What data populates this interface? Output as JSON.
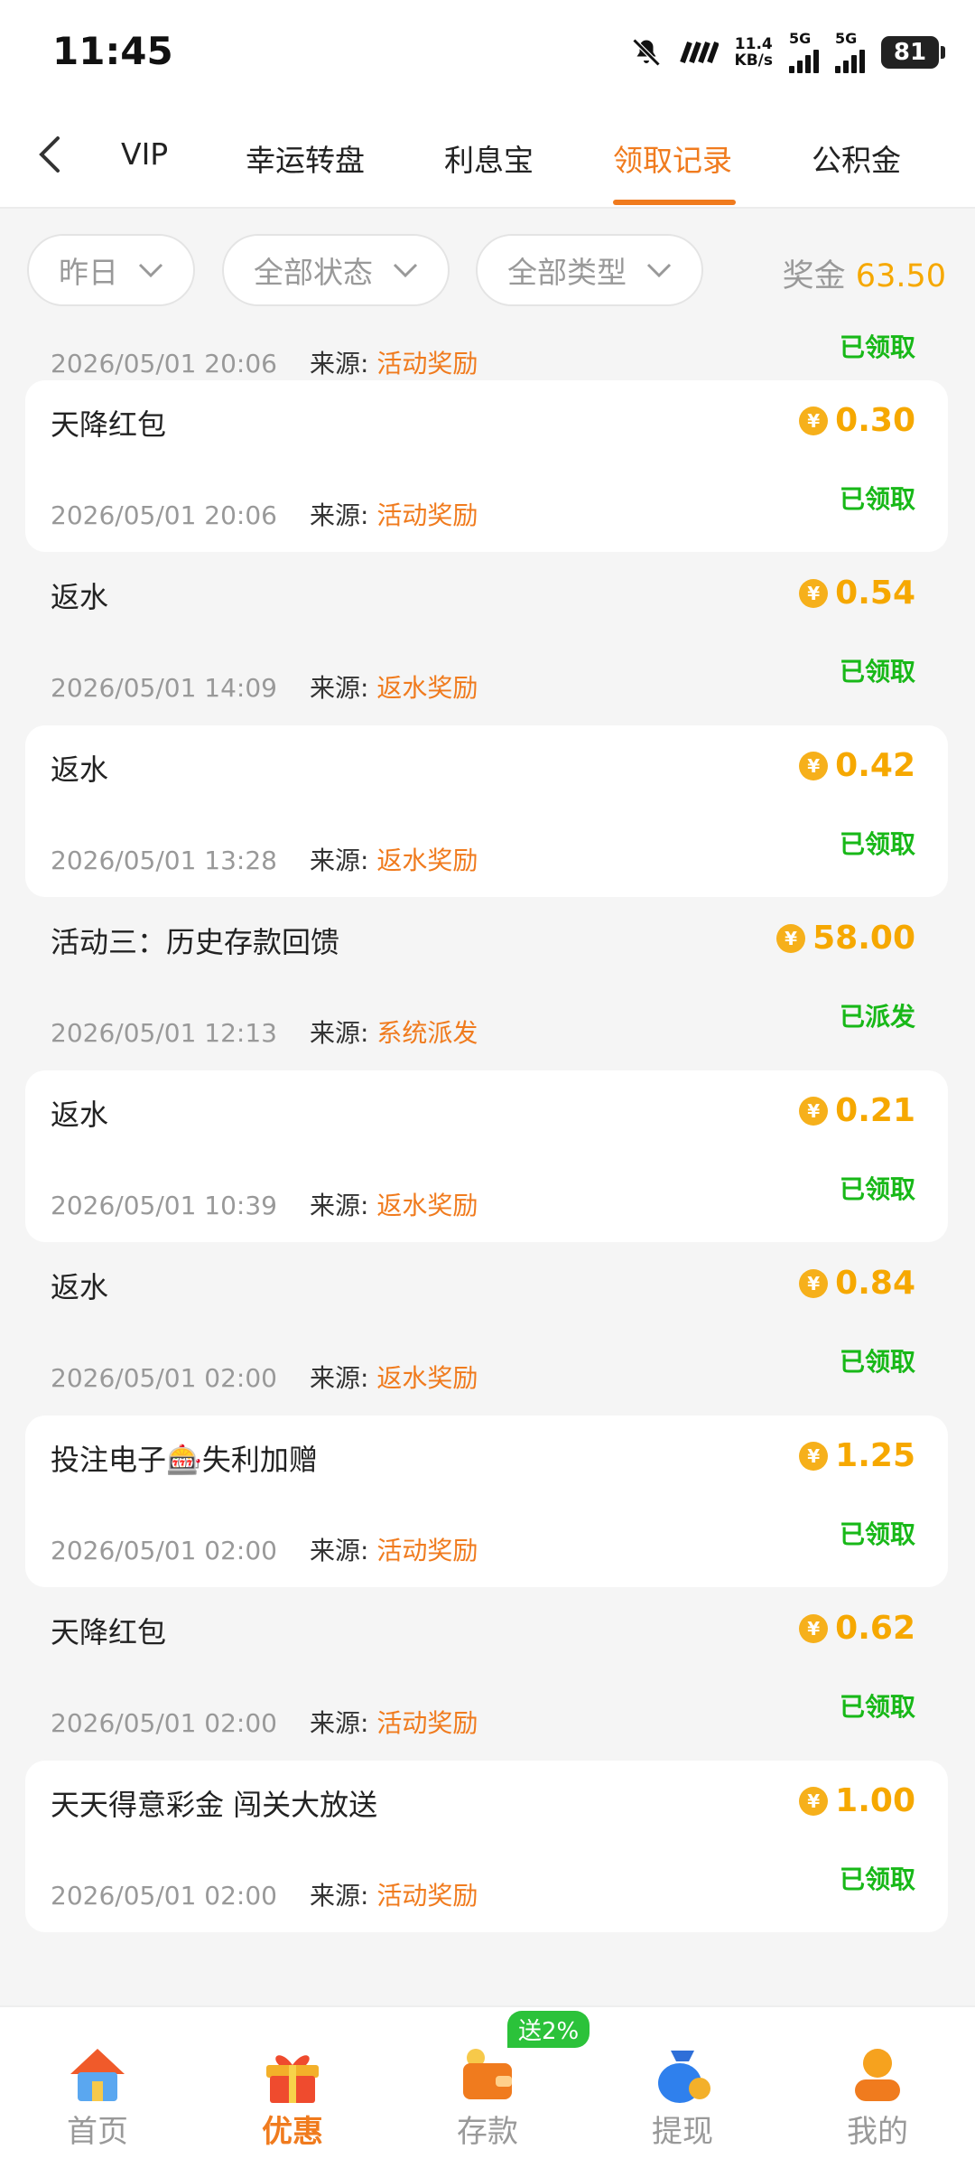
{
  "status_bar": {
    "time": "11:45",
    "speed_value": "11.4",
    "speed_unit": "KB/s",
    "net1": "5G",
    "net2": "5G",
    "battery": "81"
  },
  "tabs": [
    {
      "label": "VIP"
    },
    {
      "label": "幸运转盘"
    },
    {
      "label": "利息宝"
    },
    {
      "label": "领取记录",
      "active": true
    },
    {
      "label": "公积金"
    }
  ],
  "filters": {
    "date": "昨日",
    "status": "全部状态",
    "type": "全部类型",
    "bonus_label": "奖金",
    "bonus_value": "63.50"
  },
  "records": [
    {
      "title": "",
      "amount": "",
      "status": "已领取",
      "time": "2026/05/01 20:06",
      "source_label": "来源:",
      "source": "活动奖励"
    },
    {
      "title": "天降红包",
      "amount": "0.30",
      "status": "已领取",
      "time": "2026/05/01 20:06",
      "source_label": "来源:",
      "source": "活动奖励"
    },
    {
      "title": "返水",
      "amount": "0.54",
      "status": "已领取",
      "time": "2026/05/01 14:09",
      "source_label": "来源:",
      "source": "返水奖励"
    },
    {
      "title": "返水",
      "amount": "0.42",
      "status": "已领取",
      "time": "2026/05/01 13:28",
      "source_label": "来源:",
      "source": "返水奖励"
    },
    {
      "title": "活动三：历史存款回馈",
      "amount": "58.00",
      "status": "已派发",
      "time": "2026/05/01 12:13",
      "source_label": "来源:",
      "source": "系统派发"
    },
    {
      "title": "返水",
      "amount": "0.21",
      "status": "已领取",
      "time": "2026/05/01 10:39",
      "source_label": "来源:",
      "source": "返水奖励"
    },
    {
      "title": "返水",
      "amount": "0.84",
      "status": "已领取",
      "time": "2026/05/01 02:00",
      "source_label": "来源:",
      "source": "返水奖励"
    },
    {
      "title": "投注电子🎰失利加赠",
      "amount": "1.25",
      "status": "已领取",
      "time": "2026/05/01 02:00",
      "source_label": "来源:",
      "source": "活动奖励"
    },
    {
      "title": "天降红包",
      "amount": "0.62",
      "status": "已领取",
      "time": "2026/05/01 02:00",
      "source_label": "来源:",
      "source": "活动奖励"
    },
    {
      "title": "天天得意彩金 闯关大放送",
      "amount": "1.00",
      "status": "已领取",
      "time": "2026/05/01 02:00",
      "source_label": "来源:",
      "source": "活动奖励"
    }
  ],
  "coin_symbol": "¥",
  "bottom_nav": {
    "home": "首页",
    "promo": "优惠",
    "deposit": "存款",
    "withdraw": "提现",
    "mine": "我的",
    "deposit_badge": "送2%"
  },
  "colors": {
    "accent": "#f07b1e",
    "amount": "#f6a800",
    "status_green": "#18b818"
  }
}
